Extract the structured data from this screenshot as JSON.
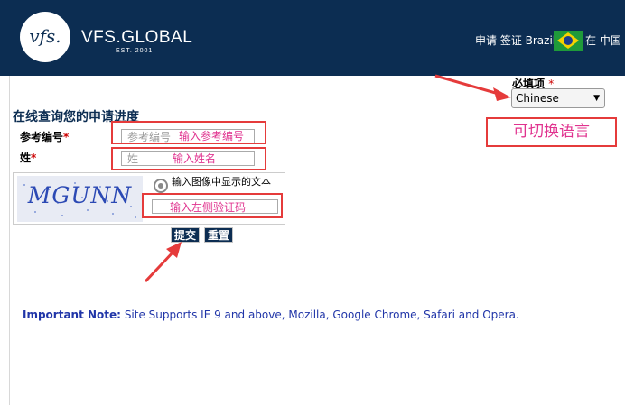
{
  "header": {
    "logo_mark": "vfs.",
    "brand": "VFS.GLOBAL",
    "est": "EST. 2001",
    "apply_visa": "申请 签证 Brazil",
    "in_china": "在 中国",
    "flag_icon": "brazil-flag-icon"
  },
  "language": {
    "required_label": "必填项",
    "required_star": "*",
    "selected": "Chinese",
    "arrow": "▼",
    "annotation": "可切换语言"
  },
  "form": {
    "title": "在线查询您的申请进度",
    "reference_label": "参考编号",
    "reference_placeholder": "参考编号",
    "reference_hint": "输入参考编号",
    "surname_label": "姓",
    "surname_placeholder": "姓",
    "surname_hint": "输入姓名",
    "required_star": "*",
    "captcha_text": "MGUNN",
    "captcha_label": "输入图像中显示的文本",
    "captcha_hint": "输入左侧验证码",
    "submit_label": "提交",
    "reset_label": "重置"
  },
  "note": {
    "label": "Important Note:",
    "text": "Site Supports IE 9 and above, Mozilla, Google Chrome, Safari and Opera."
  },
  "colors": {
    "header_bg": "#0c2d52",
    "annotation_red": "#e53b3b",
    "annotation_pink": "#e0338f",
    "note_blue": "#2035a8"
  }
}
